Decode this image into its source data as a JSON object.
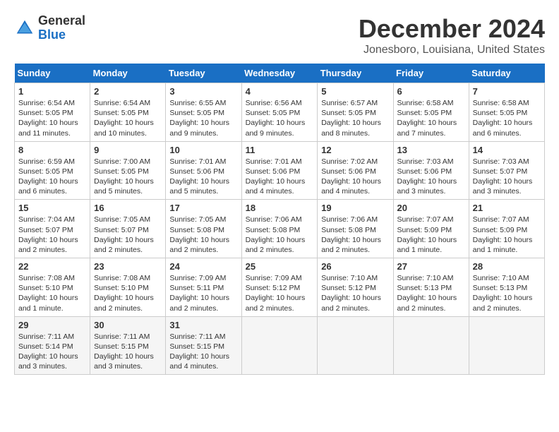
{
  "logo": {
    "general": "General",
    "blue": "Blue"
  },
  "title": "December 2024",
  "location": "Jonesboro, Louisiana, United States",
  "columns": [
    "Sunday",
    "Monday",
    "Tuesday",
    "Wednesday",
    "Thursday",
    "Friday",
    "Saturday"
  ],
  "weeks": [
    [
      {
        "day": "1",
        "sunrise": "6:54 AM",
        "sunset": "5:05 PM",
        "daylight": "10 hours and 11 minutes."
      },
      {
        "day": "2",
        "sunrise": "6:54 AM",
        "sunset": "5:05 PM",
        "daylight": "10 hours and 10 minutes."
      },
      {
        "day": "3",
        "sunrise": "6:55 AM",
        "sunset": "5:05 PM",
        "daylight": "10 hours and 9 minutes."
      },
      {
        "day": "4",
        "sunrise": "6:56 AM",
        "sunset": "5:05 PM",
        "daylight": "10 hours and 9 minutes."
      },
      {
        "day": "5",
        "sunrise": "6:57 AM",
        "sunset": "5:05 PM",
        "daylight": "10 hours and 8 minutes."
      },
      {
        "day": "6",
        "sunrise": "6:58 AM",
        "sunset": "5:05 PM",
        "daylight": "10 hours and 7 minutes."
      },
      {
        "day": "7",
        "sunrise": "6:58 AM",
        "sunset": "5:05 PM",
        "daylight": "10 hours and 6 minutes."
      }
    ],
    [
      {
        "day": "8",
        "sunrise": "6:59 AM",
        "sunset": "5:05 PM",
        "daylight": "10 hours and 6 minutes."
      },
      {
        "day": "9",
        "sunrise": "7:00 AM",
        "sunset": "5:05 PM",
        "daylight": "10 hours and 5 minutes."
      },
      {
        "day": "10",
        "sunrise": "7:01 AM",
        "sunset": "5:06 PM",
        "daylight": "10 hours and 5 minutes."
      },
      {
        "day": "11",
        "sunrise": "7:01 AM",
        "sunset": "5:06 PM",
        "daylight": "10 hours and 4 minutes."
      },
      {
        "day": "12",
        "sunrise": "7:02 AM",
        "sunset": "5:06 PM",
        "daylight": "10 hours and 4 minutes."
      },
      {
        "day": "13",
        "sunrise": "7:03 AM",
        "sunset": "5:06 PM",
        "daylight": "10 hours and 3 minutes."
      },
      {
        "day": "14",
        "sunrise": "7:03 AM",
        "sunset": "5:07 PM",
        "daylight": "10 hours and 3 minutes."
      }
    ],
    [
      {
        "day": "15",
        "sunrise": "7:04 AM",
        "sunset": "5:07 PM",
        "daylight": "10 hours and 2 minutes."
      },
      {
        "day": "16",
        "sunrise": "7:05 AM",
        "sunset": "5:07 PM",
        "daylight": "10 hours and 2 minutes."
      },
      {
        "day": "17",
        "sunrise": "7:05 AM",
        "sunset": "5:08 PM",
        "daylight": "10 hours and 2 minutes."
      },
      {
        "day": "18",
        "sunrise": "7:06 AM",
        "sunset": "5:08 PM",
        "daylight": "10 hours and 2 minutes."
      },
      {
        "day": "19",
        "sunrise": "7:06 AM",
        "sunset": "5:08 PM",
        "daylight": "10 hours and 2 minutes."
      },
      {
        "day": "20",
        "sunrise": "7:07 AM",
        "sunset": "5:09 PM",
        "daylight": "10 hours and 1 minute."
      },
      {
        "day": "21",
        "sunrise": "7:07 AM",
        "sunset": "5:09 PM",
        "daylight": "10 hours and 1 minute."
      }
    ],
    [
      {
        "day": "22",
        "sunrise": "7:08 AM",
        "sunset": "5:10 PM",
        "daylight": "10 hours and 1 minute."
      },
      {
        "day": "23",
        "sunrise": "7:08 AM",
        "sunset": "5:10 PM",
        "daylight": "10 hours and 2 minutes."
      },
      {
        "day": "24",
        "sunrise": "7:09 AM",
        "sunset": "5:11 PM",
        "daylight": "10 hours and 2 minutes."
      },
      {
        "day": "25",
        "sunrise": "7:09 AM",
        "sunset": "5:12 PM",
        "daylight": "10 hours and 2 minutes."
      },
      {
        "day": "26",
        "sunrise": "7:10 AM",
        "sunset": "5:12 PM",
        "daylight": "10 hours and 2 minutes."
      },
      {
        "day": "27",
        "sunrise": "7:10 AM",
        "sunset": "5:13 PM",
        "daylight": "10 hours and 2 minutes."
      },
      {
        "day": "28",
        "sunrise": "7:10 AM",
        "sunset": "5:13 PM",
        "daylight": "10 hours and 2 minutes."
      }
    ],
    [
      {
        "day": "29",
        "sunrise": "7:11 AM",
        "sunset": "5:14 PM",
        "daylight": "10 hours and 3 minutes."
      },
      {
        "day": "30",
        "sunrise": "7:11 AM",
        "sunset": "5:15 PM",
        "daylight": "10 hours and 3 minutes."
      },
      {
        "day": "31",
        "sunrise": "7:11 AM",
        "sunset": "5:15 PM",
        "daylight": "10 hours and 4 minutes."
      },
      null,
      null,
      null,
      null
    ]
  ]
}
